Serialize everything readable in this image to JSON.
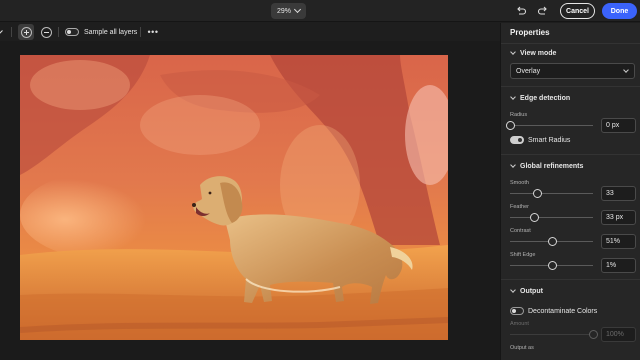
{
  "topbar": {
    "zoom": "29%",
    "cancel_label": "Cancel",
    "done_label": "Done",
    "accent_color": "#3b63fb"
  },
  "toolbar": {
    "sample_all_layers_label": "Sample all layers",
    "sample_all_layers_on": false,
    "more_glyph": "•••"
  },
  "canvas": {
    "image_subject": "golden retriever in orange-tinted overlay"
  },
  "panel": {
    "title": "Properties",
    "view_mode": {
      "title": "View mode",
      "selected": "Overlay"
    },
    "edge_detection": {
      "title": "Edge detection",
      "radius_label": "Radius",
      "radius_value": "0 px",
      "radius_level": 0,
      "smart_radius_label": "Smart Radius",
      "smart_radius_on": true
    },
    "global_refinements": {
      "title": "Global refinements",
      "smooth_label": "Smooth",
      "smooth_value": "33",
      "smooth_level": 0.33,
      "feather_label": "Feather",
      "feather_value": "33 px",
      "feather_level": 0.3,
      "contrast_label": "Contrast",
      "contrast_value": "51%",
      "contrast_level": 0.51,
      "shift_edge_label": "Shift Edge",
      "shift_edge_value": "1%",
      "shift_edge_level": 0.51
    },
    "output": {
      "title": "Output",
      "decontaminate_label": "Decontaminate Colors",
      "decontaminate_on": false,
      "amount_label": "Amount",
      "amount_value": "100%",
      "amount_level": 1,
      "output_as_label": "Output as"
    }
  }
}
